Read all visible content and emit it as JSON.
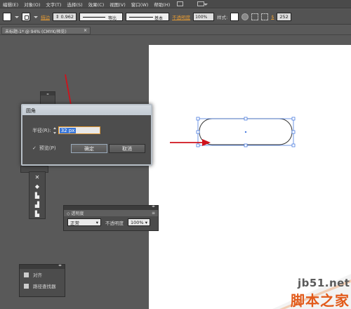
{
  "menu": {
    "items": [
      "编辑(E)",
      "对象(O)",
      "文字(T)",
      "选择(S)",
      "效果(C)",
      "视图(V)",
      "窗口(W)",
      "帮助(H)"
    ]
  },
  "control_bar": {
    "stroke_label": "描边",
    "stroke_value": "0.962",
    "profile_label": "等比",
    "brush_label": "基本",
    "opacity_label": "不透明度",
    "opacity_value": "100%",
    "style_label": "样式:",
    "x_label": "$",
    "x_value": "252"
  },
  "document_tab": {
    "title": "未标题-1* @ 94% (CMYK/预览)",
    "close": "×"
  },
  "dialog": {
    "title": "圆角",
    "radius_label": "半径(R):",
    "radius_value": "32 px",
    "preview_check": "✓",
    "preview_label": "预览(P)",
    "ok_label": "确定",
    "cancel_label": "取消"
  },
  "transparency_panel": {
    "tab_label": "◇ 透明度",
    "menu": "≡",
    "blend_mode": "正常",
    "opacity_label": "不透明度",
    "opacity_value": "100%"
  },
  "align_panel": {
    "items": [
      "对齐",
      "路径查找器"
    ]
  },
  "watermark": {
    "url": "jb51.net",
    "text": "脚本之家"
  },
  "colors": {
    "arrow": "#d0121b",
    "selection": "#4b7de0",
    "accent": "#e39a34"
  }
}
